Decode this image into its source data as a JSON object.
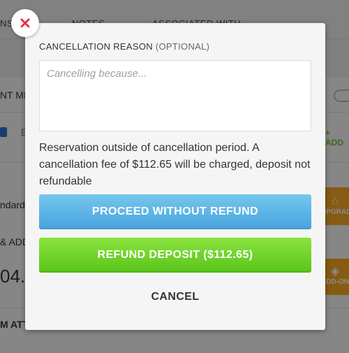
{
  "background": {
    "tabs": [
      "NS",
      "NOTES",
      "ASSOCIATED WITH"
    ],
    "rows": {
      "payment_method_fragment": "NT ME",
      "card_fragment": "E",
      "add_link": "+ ADD",
      "room_type_fragment": "ndard",
      "upgrade_label": "UPGRADE",
      "addons_fragment": "& ADD",
      "amount_fragment": "04.",
      "addon_label": "ADD-ON",
      "attr_fragment": "M ATT"
    }
  },
  "modal": {
    "reason_label": "CANCELLATION REASON",
    "reason_optional": "(OPTIONAL)",
    "reason_placeholder": "Cancelling because...",
    "reason_value": "",
    "notice": "Reservation outside of cancellation period. A cancellation fee of $112.65 will be charged, deposit not refundable",
    "proceed_button": "PROCEED WITHOUT REFUND",
    "refund_button": "REFUND DEPOSIT ($112.65)",
    "cancel_link": "CANCEL"
  },
  "colors": {
    "proceed": "#4fa9e0",
    "refund": "#62c922",
    "close_icon": "#e0314b",
    "accent_orange": "#f5a623"
  }
}
